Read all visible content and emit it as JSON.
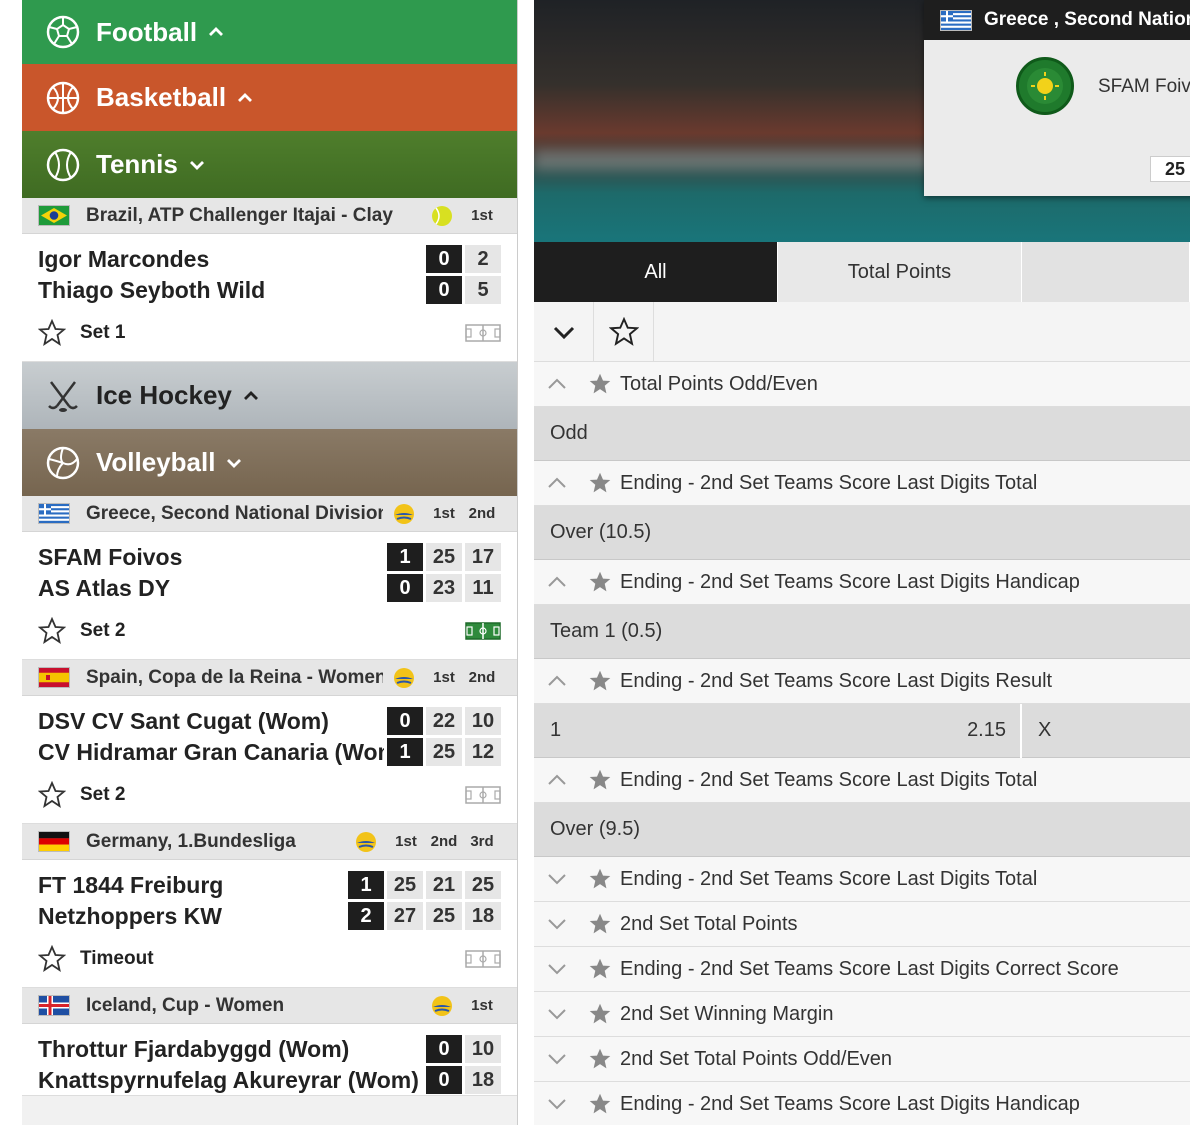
{
  "sidebar": {
    "sports": {
      "football": "Football",
      "basketball": "Basketball",
      "tennis": "Tennis",
      "hockey": "Ice Hockey",
      "volleyball": "Volleyball"
    },
    "tennis_leagues": [
      {
        "name": "Brazil, ATP Challenger Itajai - Clay",
        "set_labels": [
          "1st"
        ],
        "match": {
          "team1": "Igor Marcondes",
          "team2": "Thiago Seyboth Wild",
          "team1_scores": [
            "0",
            "2"
          ],
          "team2_scores": [
            "0",
            "5"
          ],
          "status": "Set 1"
        }
      }
    ],
    "volleyball_leagues": [
      {
        "name": "Greece, Second National Division",
        "set_labels": [
          "1st",
          "2nd"
        ],
        "match": {
          "team1": "SFAM Foivos",
          "team2": "AS Atlas DY",
          "team1_scores": [
            "1",
            "25",
            "17"
          ],
          "team2_scores": [
            "0",
            "23",
            "11"
          ],
          "status": "Set 2"
        }
      },
      {
        "name": "Spain, Copa de la Reina - Women",
        "set_labels": [
          "1st",
          "2nd"
        ],
        "match": {
          "team1": "DSV CV Sant Cugat (Wom)",
          "team2": "CV Hidramar Gran Canaria (Wom)",
          "team1_scores": [
            "0",
            "22",
            "10"
          ],
          "team2_scores": [
            "1",
            "25",
            "12"
          ],
          "status": "Set 2"
        }
      },
      {
        "name": "Germany, 1.Bundesliga",
        "set_labels": [
          "1st",
          "2nd",
          "3rd"
        ],
        "match": {
          "team1": "FT 1844 Freiburg",
          "team2": "Netzhoppers KW",
          "team1_scores": [
            "1",
            "25",
            "21",
            "25"
          ],
          "team2_scores": [
            "2",
            "27",
            "25",
            "18"
          ],
          "status": "Timeout"
        }
      },
      {
        "name": "Iceland, Cup - Women",
        "set_labels": [
          "1st"
        ],
        "match": {
          "team1": "Throttur Fjardabyggd (Wom)",
          "team2": "Knattspyrnufelag Akureyrar (Wom)",
          "team1_scores": [
            "0",
            "10"
          ],
          "team2_scores": [
            "0",
            "18"
          ]
        }
      }
    ]
  },
  "hero": {
    "popup_league": "Greece , Second National Division",
    "popup_team": "SFAM Foivos",
    "popup_score": "25"
  },
  "tabs": [
    "All",
    "Total Points"
  ],
  "markets": [
    {
      "type": "market",
      "name": "Total Points Odd/Even",
      "expanded": true
    },
    {
      "type": "selection",
      "label": "Odd"
    },
    {
      "type": "market",
      "name": "Ending - 2nd Set Teams Score Last Digits Total",
      "expanded": true
    },
    {
      "type": "selection",
      "label": "Over (10.5)"
    },
    {
      "type": "market",
      "name": "Ending - 2nd Set Teams Score Last Digits Handicap",
      "expanded": true
    },
    {
      "type": "selection",
      "label": "Team 1 (0.5)"
    },
    {
      "type": "market",
      "name": "Ending - 2nd Set Teams Score Last Digits Result",
      "expanded": true
    },
    {
      "type": "odds",
      "label": "1",
      "price": "2.15",
      "label2": "X"
    },
    {
      "type": "market",
      "name": "Ending - 2nd Set Teams Score Last Digits Total",
      "expanded": true
    },
    {
      "type": "selection",
      "label": "Over (9.5)"
    },
    {
      "type": "market",
      "name": "Ending - 2nd Set Teams Score Last Digits Total",
      "expanded": false
    },
    {
      "type": "market",
      "name": "2nd Set Total Points",
      "expanded": false
    },
    {
      "type": "market",
      "name": "Ending - 2nd Set Teams Score Last Digits Correct Score",
      "expanded": false
    },
    {
      "type": "market",
      "name": "2nd Set Winning Margin",
      "expanded": false
    },
    {
      "type": "market",
      "name": "2nd Set Total Points Odd/Even",
      "expanded": false
    },
    {
      "type": "market",
      "name": "Ending - 2nd Set Teams Score Last Digits Handicap",
      "expanded": false
    }
  ],
  "colors": {
    "football": "#2f9a4e",
    "basketball": "#c9562b",
    "tennis": "#4f7e2c",
    "volleyball": "#8a7a66",
    "dark": "#1e1e1e"
  }
}
